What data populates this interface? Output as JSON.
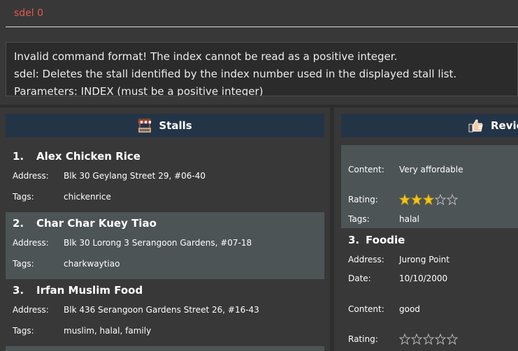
{
  "command": {
    "value": "sdel 0"
  },
  "result": {
    "lines": [
      "Invalid command format! The index cannot be read as a positive integer.",
      "sdel: Deletes the stall identified by the index number used in the displayed stall list.",
      "Parameters: INDEX (must be a positive integer)"
    ]
  },
  "stalls_panel": {
    "header": "Stalls",
    "icon": "stall-icon",
    "items": [
      {
        "index": "1.",
        "name": "Alex Chicken Rice",
        "address_label": "Address:",
        "address": "Blk 30 Geylang Street 29, #06-40",
        "tags_label": "Tags:",
        "tags": "chickenrice"
      },
      {
        "index": "2.",
        "name": "Char Char Kuey Tiao",
        "address_label": "Address:",
        "address": "Blk 30 Lorong 3 Serangoon Gardens, #07-18",
        "tags_label": "Tags:",
        "tags": "charkwaytiao"
      },
      {
        "index": "3.",
        "name": "Irfan Muslim Food",
        "address_label": "Address:",
        "address": "Blk 436 Serangoon Gardens Street 26, #16-43",
        "tags_label": "Tags:",
        "tags": "muslim, halal, family"
      }
    ]
  },
  "reviews_panel": {
    "header": "Revie",
    "icon": "thumbs-up-icon",
    "partial_item": {
      "content_label": "Content:",
      "content": "Very affordable",
      "rating_label": "Rating:",
      "rating": 3,
      "rating_max": 5,
      "tags_label": "Tags:",
      "tags": "halal"
    },
    "item": {
      "index": "3.",
      "name": "Foodie",
      "address_label": "Address:",
      "address": "Jurong Point",
      "date_label": "Date:",
      "date": "10/10/2000",
      "content_label": "Content:",
      "content": "good",
      "rating_label": "Rating:",
      "rating": 0,
      "rating_max": 5
    }
  },
  "colors": {
    "header_bg": "#243447",
    "alt_row_bg": "#4d5456",
    "command_text": "#e05a4d",
    "star_filled": "#f5c518"
  }
}
